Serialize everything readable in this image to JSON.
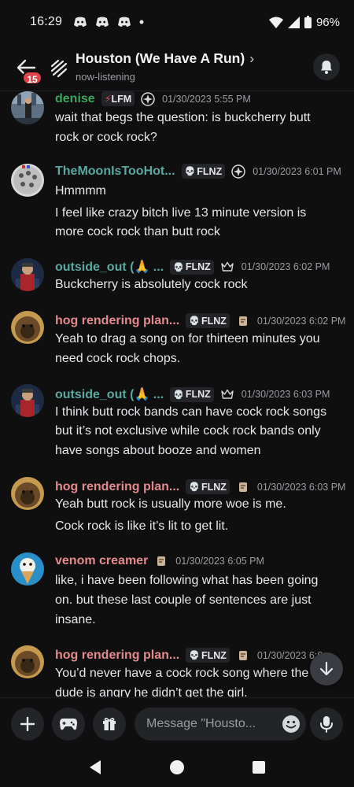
{
  "status_bar": {
    "time": "16:29",
    "battery_pct": "96%",
    "notification_icons": [
      "discord-icon",
      "discord-icon",
      "discord-icon",
      "dot"
    ]
  },
  "header": {
    "back_badge": "15",
    "title": "Houston (We Have A Run)",
    "chevron": "›",
    "subtitle": "now-listening"
  },
  "colors": {
    "background": "#0f0f10",
    "green_name": "#3ba55d",
    "teal_name": "#5ba7a0",
    "pink_name": "#e38a8e",
    "lfm_red": "#e2424a"
  },
  "messages": [
    {
      "author": "denise",
      "tag": "LFM",
      "timestamp": "01/30/2023 5:55 PM",
      "lines": [
        "wait that begs the question: is buckcherry butt",
        "rock or cock rock?"
      ]
    },
    {
      "author": "TheMoonIsTooHot...",
      "tag": "FLNZ",
      "timestamp": "01/30/2023 6:01 PM",
      "lines": [
        "Hmmmm",
        "I feel like crazy bitch live 13 minute version is",
        "more cock rock than butt rock"
      ]
    },
    {
      "author": "outside_out (🙏 ...",
      "tag": "FLNZ",
      "timestamp": "01/30/2023 6:02 PM",
      "lines": [
        "Buckcherry is absolutely cock rock"
      ]
    },
    {
      "author": "hog rendering plan...",
      "tag": "FLNZ",
      "timestamp": "01/30/2023 6:02 PM",
      "lines": [
        "Yeah to drag a song on for thirteen minutes you",
        "need cock rock chops."
      ]
    },
    {
      "author": "outside_out (🙏 ...",
      "tag": "FLNZ",
      "timestamp": "01/30/2023 6:03 PM",
      "lines": [
        "I think butt rock bands can have cock rock songs",
        "but it’s not exclusive while cock rock bands only",
        "have songs about booze and women"
      ]
    },
    {
      "author": "hog rendering plan...",
      "tag": "FLNZ",
      "timestamp": "01/30/2023 6:03 PM",
      "lines": [
        "Yeah butt rock is usually more woe is me.",
        "Cock rock is like it’s lit to get lit."
      ]
    },
    {
      "author": "venom creamer",
      "tag": "",
      "timestamp": "01/30/2023 6:05 PM",
      "lines": [
        "like, i have been following what has been going",
        "on. but these last couple of sentences are just",
        "insane."
      ]
    },
    {
      "author": "hog rendering plan...",
      "tag": "FLNZ",
      "timestamp": "01/30/2023 6:0",
      "lines": [
        "You’d never have a cock rock song where the",
        "dude is angry he didn’t get the girl."
      ]
    }
  ],
  "composer": {
    "placeholder": "Message \"Housto..."
  }
}
